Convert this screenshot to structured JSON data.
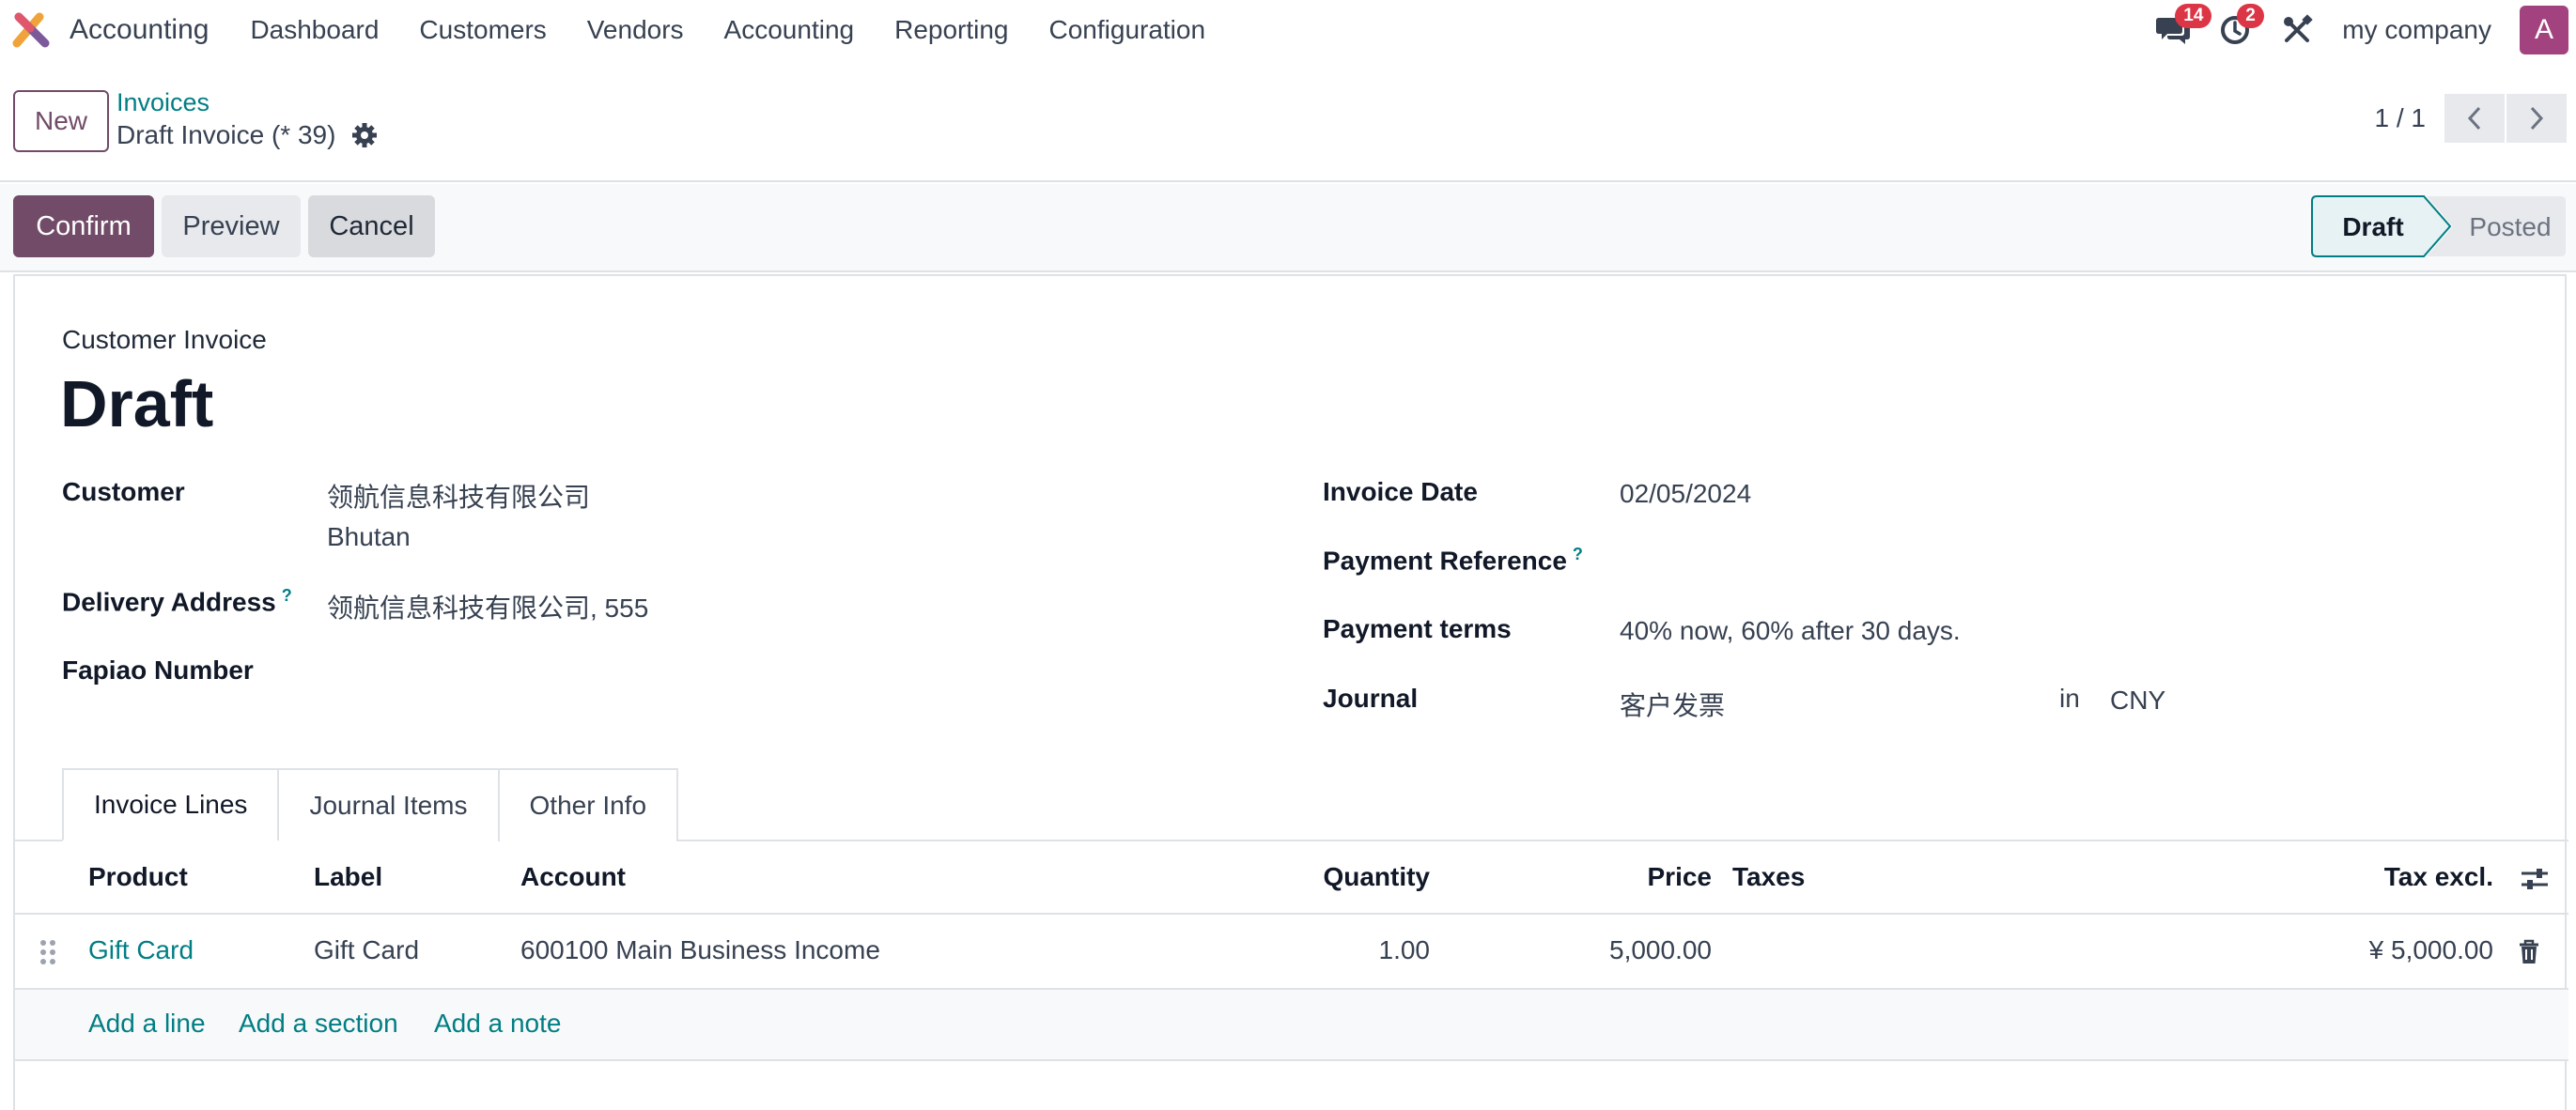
{
  "navbar": {
    "app_name": "Accounting",
    "menu": [
      "Dashboard",
      "Customers",
      "Vendors",
      "Accounting",
      "Reporting",
      "Configuration"
    ],
    "messages_count": "14",
    "activities_count": "2",
    "company": "my company",
    "avatar_letter": "A"
  },
  "control_panel": {
    "new_label": "New",
    "breadcrumb": "Invoices",
    "record_title": "Draft Invoice (* 39)",
    "pager": "1 / 1"
  },
  "actions": {
    "confirm": "Confirm",
    "preview": "Preview",
    "cancel": "Cancel"
  },
  "status": {
    "steps": [
      "Draft",
      "Posted"
    ],
    "current": "Draft"
  },
  "invoice": {
    "type": "Customer Invoice",
    "name": "Draft",
    "customer_label": "Customer",
    "customer_name": "领航信息科技有限公司",
    "customer_country": "Bhutan",
    "delivery_label": "Delivery Address",
    "delivery_value": "领航信息科技有限公司, 555",
    "fapiao_label": "Fapiao Number",
    "invoice_date_label": "Invoice Date",
    "invoice_date": "02/05/2024",
    "payment_ref_label": "Payment Reference",
    "payment_terms_label": "Payment terms",
    "payment_terms": "40% now, 60% after 30 days.",
    "journal_label": "Journal",
    "journal": "客户发票",
    "in_label": "in",
    "currency": "CNY",
    "help_mark": "?"
  },
  "tabs": [
    "Invoice Lines",
    "Journal Items",
    "Other Info"
  ],
  "lines_table": {
    "headers": {
      "product": "Product",
      "label": "Label",
      "account": "Account",
      "quantity": "Quantity",
      "price": "Price",
      "taxes": "Taxes",
      "tax_excl": "Tax excl."
    },
    "rows": [
      {
        "product": "Gift Card",
        "label": "Gift Card",
        "account": "600100 Main Business Income",
        "quantity": "1.00",
        "price": "5,000.00",
        "taxes": "",
        "tax_excl": "¥ 5,000.00"
      }
    ],
    "add_line": "Add a line",
    "add_section": "Add a section",
    "add_note": "Add a note"
  },
  "colors": {
    "primary": "#714b67",
    "link": "#017e84",
    "badge": "#dc3545",
    "avatar": "#a2437f"
  }
}
